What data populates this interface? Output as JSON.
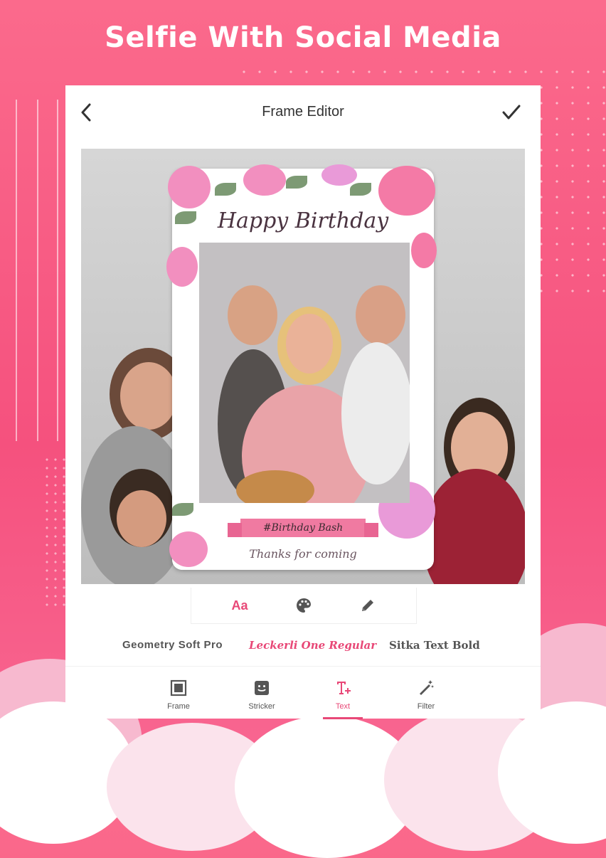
{
  "hero": {
    "title": "Selfie With Social Media"
  },
  "editor": {
    "title": "Frame Editor"
  },
  "frame": {
    "heading": "Happy Birthday",
    "ribbon": "#Birthday Bash",
    "footer": "Thanks for coming"
  },
  "text_tools": {
    "font_label": "Aa"
  },
  "fonts": [
    "Geometry Soft Pro",
    "Leckerli One Regular",
    "Sitka Text Bold"
  ],
  "tabs": [
    {
      "label": "Frame",
      "icon": "frame-icon"
    },
    {
      "label": "Stricker",
      "icon": "sticker-icon"
    },
    {
      "label": "Text",
      "icon": "text-icon",
      "active": true
    },
    {
      "label": "Filter",
      "icon": "magic-wand-icon"
    }
  ],
  "colors": {
    "accent": "#e84877",
    "background": "#f5517e"
  }
}
